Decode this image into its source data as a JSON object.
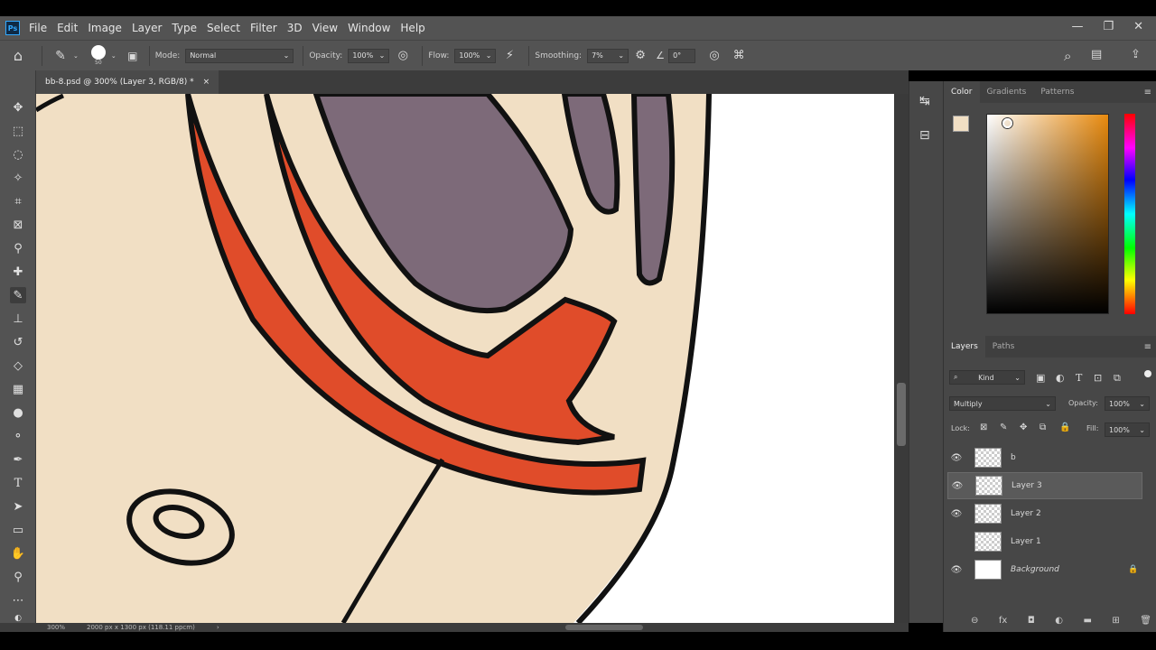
{
  "menu": {
    "logo": "Ps",
    "items": [
      "File",
      "Edit",
      "Image",
      "Layer",
      "Type",
      "Select",
      "Filter",
      "3D",
      "View",
      "Window",
      "Help"
    ],
    "window_controls": [
      "—",
      "❐",
      "✕"
    ]
  },
  "options": {
    "brush_size": "50",
    "mode_label": "Mode:",
    "mode_value": "Normal",
    "opacity_label": "Opacity:",
    "opacity_value": "100%",
    "flow_label": "Flow:",
    "flow_value": "100%",
    "smoothing_label": "Smoothing:",
    "smoothing_value": "7%",
    "angle_value": "0°"
  },
  "document": {
    "tab_title": "bb-8.psd @ 300% (Layer 3, RGB/8) *",
    "close": "×"
  },
  "status": {
    "zoom": "300%",
    "doc_size": "2000 px x 1300 px (118.11 ppcm)",
    "arrow": "›"
  },
  "color_panel": {
    "tabs": [
      "Color",
      "Gradients",
      "Patterns"
    ],
    "colors": {
      "accent": "#e88a0e",
      "foreground": "#f1dfc4",
      "background": "#ffffff"
    }
  },
  "layers_panel": {
    "tabs": [
      "Layers",
      "Paths"
    ],
    "filter_label": "Kind",
    "blend_mode": "Multiply",
    "opacity_label": "Opacity:",
    "opacity_value": "100%",
    "lock_label": "Lock:",
    "fill_label": "Fill:",
    "fill_value": "100%",
    "layers": [
      {
        "name": "b",
        "visible": true,
        "selected": false
      },
      {
        "name": "Layer 3",
        "visible": true,
        "selected": true
      },
      {
        "name": "Layer 2",
        "visible": true,
        "selected": false
      },
      {
        "name": "Layer 1",
        "visible": false,
        "selected": false
      },
      {
        "name": "Background",
        "visible": true,
        "selected": false,
        "locked": true
      }
    ],
    "footer_icons": [
      "link-icon",
      "fx-icon",
      "mask-icon",
      "adjustment-icon",
      "folder-icon",
      "new-layer-icon",
      "trash-icon"
    ],
    "footer_glyphs": [
      "⊖",
      "fx",
      "◘",
      "◐",
      "▬",
      "⊞",
      "🗑"
    ]
  },
  "artwork_colors": {
    "skin": "#f1dfc4",
    "stripe": "#e04c2a",
    "visor": "#7d6a79",
    "outline": "#111111",
    "page": "#ffffff"
  }
}
